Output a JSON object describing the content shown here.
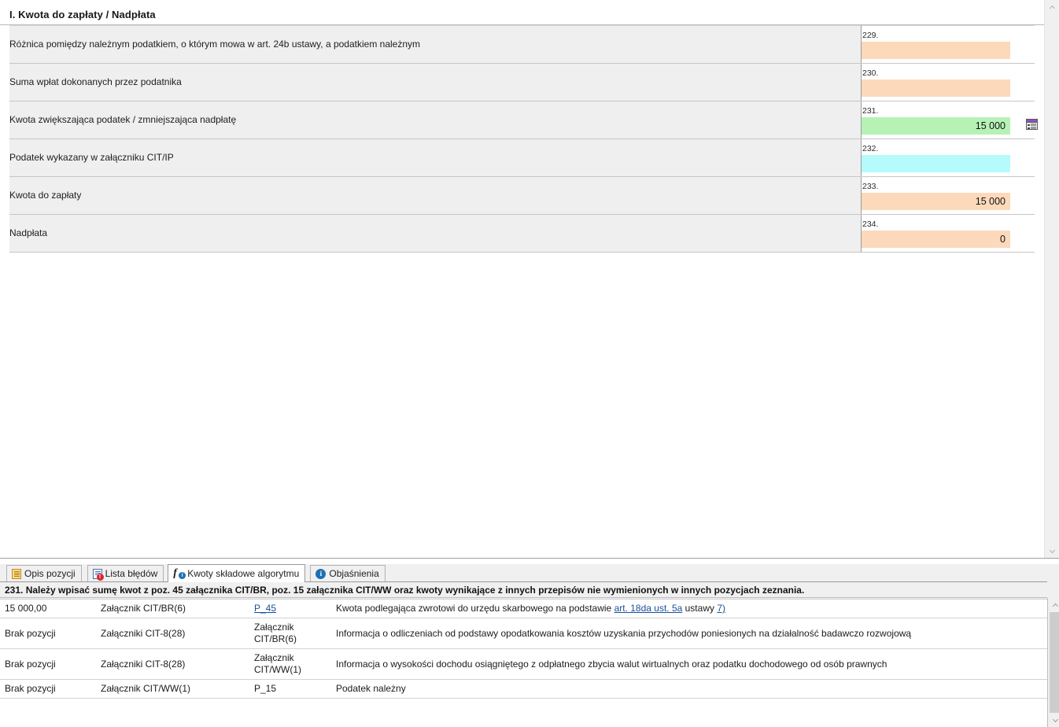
{
  "form": {
    "section_title": "I. Kwota do zapłaty / Nadpłata",
    "rows": [
      {
        "label": "Różnica pomiędzy należnym podatkiem, o którym mowa w art. 24b ustawy, a podatkiem należnym",
        "number": "229.",
        "value": "",
        "color": "#fdd9bb",
        "color_name": "orange",
        "has_dialog_icon": false
      },
      {
        "label": "Suma wpłat dokonanych przez podatnika",
        "number": "230.",
        "value": "",
        "color": "#fdd9bb",
        "color_name": "orange",
        "has_dialog_icon": false
      },
      {
        "label": "Kwota zwiększająca podatek / zmniejszająca nadpłatę",
        "number": "231.",
        "value": "15 000",
        "color": "#b6f2b6",
        "color_name": "green",
        "has_dialog_icon": true
      },
      {
        "label": "Podatek wykazany w załączniku CIT/IP",
        "number": "232.",
        "value": "",
        "color": "#b5fbfb",
        "color_name": "cyan",
        "has_dialog_icon": false
      },
      {
        "label": "Kwota do zapłaty",
        "number": "233.",
        "value": "15 000",
        "color": "#fdd9bb",
        "color_name": "orange",
        "has_dialog_icon": false
      },
      {
        "label": "Nadpłata",
        "number": "234.",
        "value": "0",
        "color": "#fdd9bb",
        "color_name": "orange",
        "has_dialog_icon": false
      }
    ]
  },
  "bottom": {
    "tabs": [
      {
        "label": "Opis pozycji",
        "icon": "document-icon",
        "active": false
      },
      {
        "label": "Lista błędów",
        "icon": "error-list-icon",
        "active": false
      },
      {
        "label": "Kwoty składowe algorytmu",
        "icon": "function-info-icon",
        "active": true
      },
      {
        "label": "Objaśnienia",
        "icon": "info-icon",
        "active": false
      }
    ],
    "banner": "231. Należy wpisać sumę kwot z poz. 45 załącznika CIT/BR, poz. 15 załącznika CIT/WW oraz kwoty wynikające z innych przepisów nie wymienionych w innych pozycjach zeznania.",
    "rows": [
      {
        "amount": "15 000,00",
        "amount_missing": false,
        "attachment": "Załącznik CIT/BR(6)",
        "position": "P_45",
        "position_is_link": true,
        "description_pre": "Kwota podlegająca zwrotowi do urzędu skarbowego na podstawie ",
        "description_link": "art. 18da ust. 5a",
        "description_mid": " ustawy ",
        "description_link2": "7)",
        "description_post": ""
      },
      {
        "amount": "Brak pozycji",
        "amount_missing": true,
        "attachment": "Załączniki CIT-8(28)",
        "position": "Załącznik CIT/BR(6)",
        "position_is_link": false,
        "description_pre": "Informacja o odliczeniach od podstawy opodatkowania kosztów uzyskania przychodów poniesionych na działalność badawczo rozwojową",
        "description_link": "",
        "description_mid": "",
        "description_link2": "",
        "description_post": ""
      },
      {
        "amount": "Brak pozycji",
        "amount_missing": true,
        "attachment": "Załączniki CIT-8(28)",
        "position": "Załącznik CIT/WW(1)",
        "position_is_link": false,
        "description_pre": "Informacja o wysokości dochodu osiągniętego z odpłatnego zbycia walut wirtualnych oraz podatku dochodowego od osób prawnych",
        "description_link": "",
        "description_mid": "",
        "description_link2": "",
        "description_post": ""
      },
      {
        "amount": "Brak pozycji",
        "amount_missing": true,
        "attachment": "Załącznik CIT/WW(1)",
        "position": "P_15",
        "position_is_link": false,
        "description_pre": "Podatek należny",
        "description_link": "",
        "description_mid": "",
        "description_link2": "",
        "description_post": ""
      }
    ]
  },
  "scrollbars": {
    "up_arrow": "▲",
    "down_arrow": "▼"
  },
  "colors": {
    "field_orange": "#fdd9bb",
    "field_green": "#b6f2b6",
    "field_cyan": "#b5fbfb",
    "label_bg": "#efeff0",
    "error_red": "#e2302f",
    "link_blue": "#1a4f9c"
  }
}
